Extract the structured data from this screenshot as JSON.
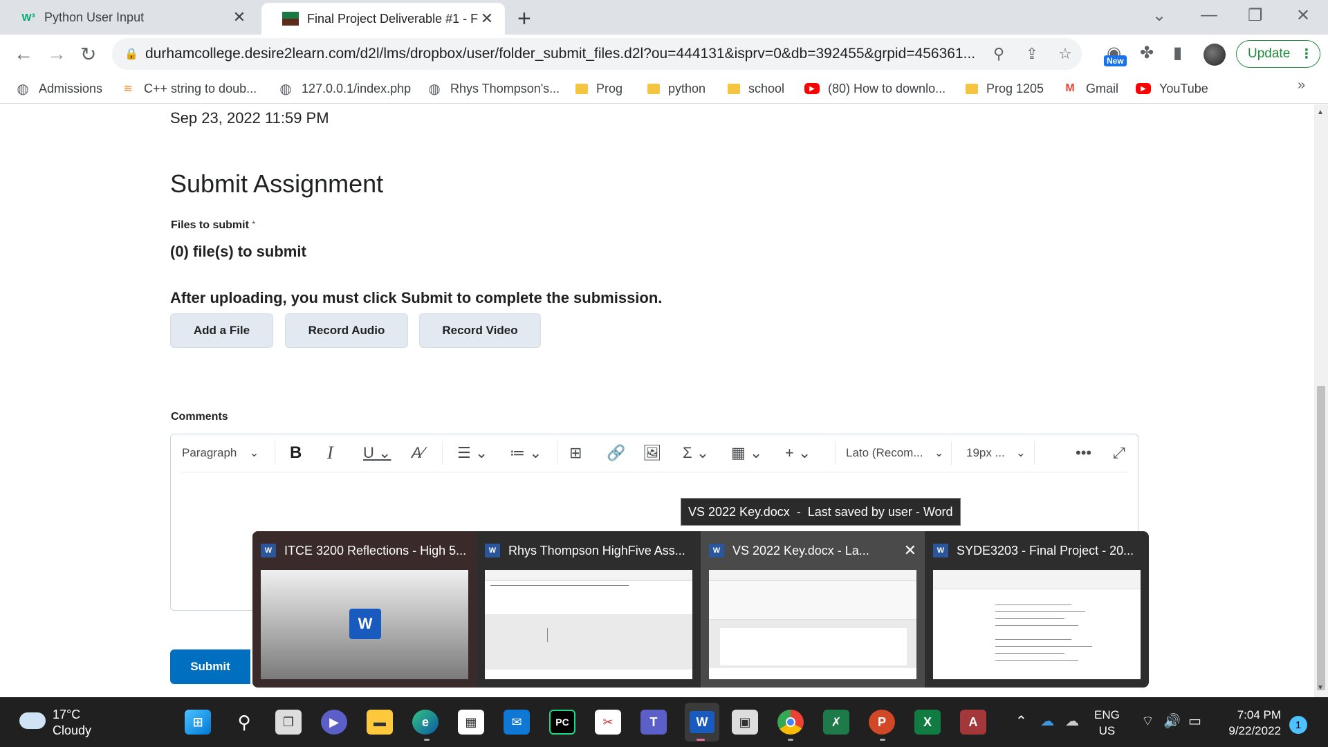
{
  "browser": {
    "tabs": [
      {
        "title": "Python User Input",
        "favicon": "w3schools-icon"
      },
      {
        "title": "Final Project Deliverable #1 - For",
        "favicon": "d2l-icon"
      }
    ],
    "url": "durhamcollege.desire2learn.com/d2l/lms/dropbox/user/folder_submit_files.d2l?ou=444131&isprv=0&db=392455&grpid=456361...",
    "new_badge": "New",
    "update_label": "Update",
    "bookmarks": [
      {
        "label": "Admissions",
        "icon": "globe-icon"
      },
      {
        "label": "C++ string to doub...",
        "icon": "stackoverflow-icon"
      },
      {
        "label": "127.0.0.1/index.php",
        "icon": "globe-icon"
      },
      {
        "label": "Rhys Thompson's...",
        "icon": "globe-icon"
      },
      {
        "label": "Prog",
        "icon": "folder-icon"
      },
      {
        "label": "python",
        "icon": "folder-icon"
      },
      {
        "label": "school",
        "icon": "folder-icon"
      },
      {
        "label": "(80) How to downlo...",
        "icon": "youtube-icon"
      },
      {
        "label": "Prog 1205",
        "icon": "folder-icon"
      },
      {
        "label": "Gmail",
        "icon": "gmail-icon"
      },
      {
        "label": "YouTube",
        "icon": "youtube-icon"
      }
    ],
    "bookmarks_overflow": "»"
  },
  "page": {
    "due_date": "Sep 23, 2022 11:59 PM",
    "heading": "Submit Assignment",
    "files_label": "Files to submit",
    "required_mark": "*",
    "file_count": "(0) file(s) to submit",
    "instruction": "After uploading, you must click Submit to complete the submission.",
    "buttons": {
      "add_file": "Add a File",
      "record_audio": "Record Audio",
      "record_video": "Record Video"
    },
    "comments_label": "Comments",
    "editor": {
      "format": "Paragraph",
      "font": "Lato (Recom...",
      "size": "19px ..."
    },
    "submit_label": "Submit"
  },
  "tooltip": "VS 2022 Key.docx  -  Last saved by user - Word",
  "previews": [
    {
      "title": "ITCE 3200 Reflections - High 5..."
    },
    {
      "title": "Rhys Thompson HighFive Ass..."
    },
    {
      "title": "VS 2022 Key.docx  -  La..."
    },
    {
      "title": "SYDE3203 - Final Project - 20..."
    }
  ],
  "taskbar": {
    "temperature": "17°C",
    "condition": "Cloudy",
    "lang_line1": "ENG",
    "lang_line2": "US",
    "time": "7:04 PM",
    "date": "9/22/2022",
    "notifications": "1"
  }
}
